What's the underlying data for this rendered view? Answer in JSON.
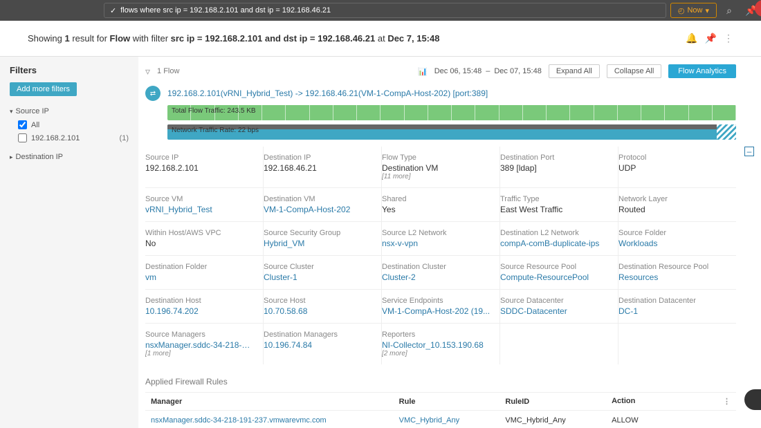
{
  "topbar": {
    "query": "flows where src ip = 192.168.2.101 and dst ip = 192.168.46.21",
    "now_label": "Now"
  },
  "result_summary": {
    "prefix": "Showing ",
    "count": "1",
    "mid1": " result for ",
    "entity": "Flow",
    "mid2": " with filter ",
    "filter": "src ip = 192.168.2.101 and dst ip = 192.168.46.21",
    "mid3": " at ",
    "time": "Dec 7, 15:48"
  },
  "sidebar": {
    "title": "Filters",
    "add_btn": "Add more filters",
    "groups": [
      {
        "name": "Source IP",
        "open": true,
        "id": "source-ip",
        "items": [
          {
            "label": "All",
            "checked": true,
            "count": ""
          },
          {
            "label": "192.168.2.101",
            "checked": false,
            "count": "(1)"
          }
        ]
      },
      {
        "name": "Destination IP",
        "open": false,
        "id": "destination-ip",
        "items": []
      }
    ]
  },
  "content_top": {
    "flow_count": "1 Flow",
    "range_from": "Dec 06, 15:48",
    "range_to": "Dec 07, 15:48",
    "expand": "Expand All",
    "collapse": "Collapse All",
    "analytics": "Flow Analytics"
  },
  "flow": {
    "title": "192.168.2.101(vRNI_Hybrid_Test) -> 192.168.46.21(VM-1-CompA-Host-202) [port:389]",
    "bar1_label": "Total Flow Traffic: 243.5 KB",
    "bar2_label": "Network Traffic Rate: 22 bps"
  },
  "details": [
    [
      {
        "label": "Source IP",
        "value": "192.168.2.101",
        "link": false,
        "more": ""
      },
      {
        "label": "Destination IP",
        "value": "192.168.46.21",
        "link": false,
        "more": ""
      },
      {
        "label": "Flow Type",
        "value": "Destination VM",
        "link": false,
        "more": "[11 more]"
      },
      {
        "label": "Destination Port",
        "value": "389 [ldap]",
        "link": false,
        "more": ""
      },
      {
        "label": "Protocol",
        "value": "UDP",
        "link": false,
        "more": ""
      }
    ],
    [
      {
        "label": "Source VM",
        "value": "vRNI_Hybrid_Test",
        "link": true,
        "more": ""
      },
      {
        "label": "Destination VM",
        "value": "VM-1-CompA-Host-202",
        "link": true,
        "more": ""
      },
      {
        "label": "Shared",
        "value": "Yes",
        "link": false,
        "more": ""
      },
      {
        "label": "Traffic Type",
        "value": "East West Traffic",
        "link": false,
        "more": ""
      },
      {
        "label": "Network Layer",
        "value": "Routed",
        "link": false,
        "more": ""
      }
    ],
    [
      {
        "label": "Within Host/AWS VPC",
        "value": "No",
        "link": false,
        "more": ""
      },
      {
        "label": "Source Security Group",
        "value": "Hybrid_VM",
        "link": true,
        "more": ""
      },
      {
        "label": "Source L2 Network",
        "value": "nsx-v-vpn",
        "link": true,
        "more": ""
      },
      {
        "label": "Destination L2 Network",
        "value": "compA-comB-duplicate-ips",
        "link": true,
        "more": ""
      },
      {
        "label": "Source Folder",
        "value": "Workloads",
        "link": true,
        "more": ""
      }
    ],
    [
      {
        "label": "Destination Folder",
        "value": "vm",
        "link": true,
        "more": ""
      },
      {
        "label": "Source Cluster",
        "value": "Cluster-1",
        "link": true,
        "more": ""
      },
      {
        "label": "Destination Cluster",
        "value": "Cluster-2",
        "link": true,
        "more": ""
      },
      {
        "label": "Source Resource Pool",
        "value": "Compute-ResourcePool",
        "link": true,
        "more": ""
      },
      {
        "label": "Destination Resource Pool",
        "value": "Resources",
        "link": true,
        "more": ""
      }
    ],
    [
      {
        "label": "Destination Host",
        "value": "10.196.74.202",
        "link": true,
        "more": ""
      },
      {
        "label": "Source Host",
        "value": "10.70.58.68",
        "link": true,
        "more": ""
      },
      {
        "label": "Service Endpoints",
        "value": "VM-1-CompA-Host-202 (19...",
        "link": true,
        "more": ""
      },
      {
        "label": "Source Datacenter",
        "value": "SDDC-Datacenter",
        "link": true,
        "more": ""
      },
      {
        "label": "Destination Datacenter",
        "value": "DC-1",
        "link": true,
        "more": ""
      }
    ],
    [
      {
        "label": "Source Managers",
        "value": "nsxManager.sddc-34-218-19...",
        "link": true,
        "more": "[1 more]"
      },
      {
        "label": "Destination Managers",
        "value": "10.196.74.84",
        "link": true,
        "more": ""
      },
      {
        "label": "Reporters",
        "value": "NI-Collector_10.153.190.68",
        "link": true,
        "more": "[2 more]"
      },
      {
        "label": "",
        "value": "",
        "link": false,
        "more": ""
      },
      {
        "label": "",
        "value": "",
        "link": false,
        "more": ""
      }
    ]
  ],
  "firewall": {
    "title": "Applied Firewall Rules",
    "headers": {
      "manager": "Manager",
      "rule": "Rule",
      "ruleid": "RuleID",
      "action": "Action"
    },
    "rows": [
      {
        "manager": "nsxManager.sddc-34-218-191-237.vmwarevmc.com",
        "rule": "VMC_Hybrid_Any",
        "ruleid": "VMC_Hybrid_Any",
        "action": "ALLOW"
      }
    ]
  },
  "icons": {
    "check": "✓",
    "clock": "◴",
    "chevron_down": "▾",
    "search": "⌕",
    "pin": "📌",
    "bell": "🔔",
    "kebab": "⋮",
    "collapse": "⊟",
    "dash": "–",
    "chart": "📊"
  }
}
